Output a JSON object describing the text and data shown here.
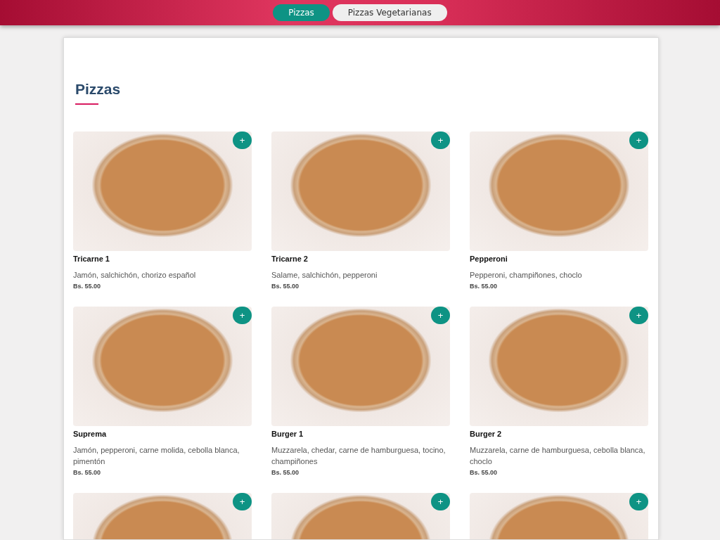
{
  "tabs": [
    {
      "label": "Pizzas",
      "selected": true
    },
    {
      "label": "Pizzas Vegetarianas",
      "selected": false
    }
  ],
  "section": {
    "title": "Pizzas"
  },
  "items": [
    {
      "add_label": "+",
      "name": "Tricarne 1",
      "description": "Jamón, salchichón, chorizo español",
      "price": "Bs. 55.00"
    },
    {
      "add_label": "+",
      "name": "Tricarne 2",
      "description": "Salame, salchichón, pepperoni",
      "price": "Bs. 55.00"
    },
    {
      "add_label": "+",
      "name": "Pepperoni",
      "description": "Pepperoni, champiñones, choclo",
      "price": "Bs. 55.00"
    },
    {
      "add_label": "+",
      "name": "Suprema",
      "description": "Jamón, pepperoni, carne molida, cebolla blanca, pimentón",
      "price": "Bs. 55.00"
    },
    {
      "add_label": "+",
      "name": "Burger 1",
      "description": "Muzzarela, chedar, carne de hamburguesa, tocino, champiñones",
      "price": "Bs. 55.00"
    },
    {
      "add_label": "+",
      "name": "Burger 2",
      "description": "Muzzarela, carne de hamburguesa, cebolla blanca, choclo",
      "price": "Bs. 55.00"
    },
    {
      "add_label": "+"
    },
    {
      "add_label": "+"
    },
    {
      "add_label": "+"
    }
  ]
}
